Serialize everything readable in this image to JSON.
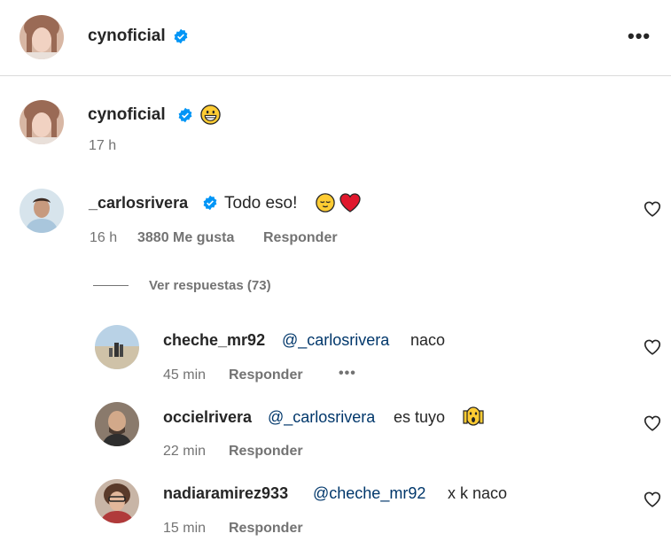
{
  "post": {
    "author": "cynoficial",
    "more_label": "•••"
  },
  "caption": {
    "author": "cynoficial",
    "emoji": "grinning-face",
    "time": "17 h"
  },
  "comment": {
    "author": "_carlosrivera",
    "text": "Todo eso!",
    "emojis": [
      "relieved-face",
      "red-heart"
    ],
    "time": "16 h",
    "likes": "3880 Me gusta",
    "reply_label": "Responder",
    "view_replies": "Ver respuestas (73)"
  },
  "replies": [
    {
      "author": "cheche_mr92",
      "mention": "@_carlosrivera",
      "text": "naco",
      "time": "45 min",
      "reply_label": "Responder",
      "more_label": "•••"
    },
    {
      "author": "occielrivera",
      "mention": "@_carlosrivera",
      "text": "es tuyo",
      "emoji": "face-screaming-in-fear",
      "time": "22 min",
      "reply_label": "Responder"
    },
    {
      "author": "nadiaramirez933",
      "mention": "@cheche_mr92",
      "text": "x k naco",
      "time": "15 min",
      "reply_label": "Responder"
    }
  ],
  "colors": {
    "verified": "#0095f6",
    "link": "#00376b",
    "meta": "#737373",
    "heart": "#ed4956"
  }
}
